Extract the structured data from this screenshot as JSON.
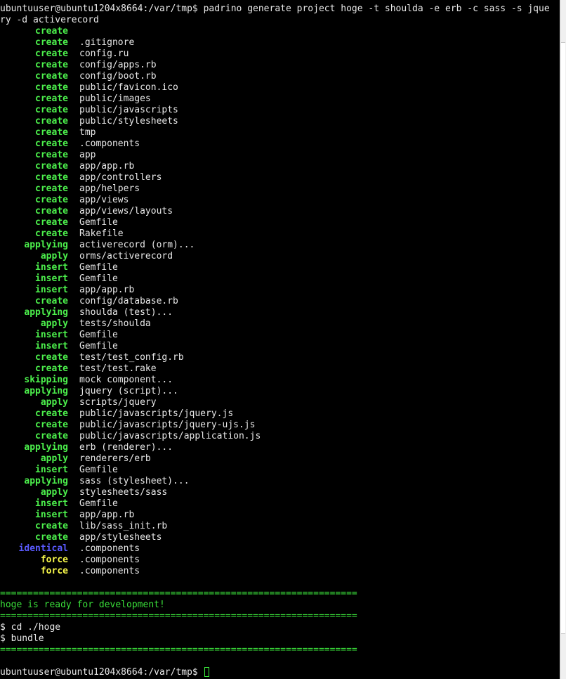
{
  "command": {
    "line1": "ubuntuuser@ubuntu1204x8664:/var/tmp$ padrino generate project hoge -t shoulda -e erb -c sass -s jque",
    "line2": "ry -d activerecord"
  },
  "output_lines": [
    {
      "status": "create",
      "color": "green",
      "path": ""
    },
    {
      "status": "create",
      "color": "green",
      "path": ".gitignore"
    },
    {
      "status": "create",
      "color": "green",
      "path": "config.ru"
    },
    {
      "status": "create",
      "color": "green",
      "path": "config/apps.rb"
    },
    {
      "status": "create",
      "color": "green",
      "path": "config/boot.rb"
    },
    {
      "status": "create",
      "color": "green",
      "path": "public/favicon.ico"
    },
    {
      "status": "create",
      "color": "green",
      "path": "public/images"
    },
    {
      "status": "create",
      "color": "green",
      "path": "public/javascripts"
    },
    {
      "status": "create",
      "color": "green",
      "path": "public/stylesheets"
    },
    {
      "status": "create",
      "color": "green",
      "path": "tmp"
    },
    {
      "status": "create",
      "color": "green",
      "path": ".components"
    },
    {
      "status": "create",
      "color": "green",
      "path": "app"
    },
    {
      "status": "create",
      "color": "green",
      "path": "app/app.rb"
    },
    {
      "status": "create",
      "color": "green",
      "path": "app/controllers"
    },
    {
      "status": "create",
      "color": "green",
      "path": "app/helpers"
    },
    {
      "status": "create",
      "color": "green",
      "path": "app/views"
    },
    {
      "status": "create",
      "color": "green",
      "path": "app/views/layouts"
    },
    {
      "status": "create",
      "color": "green",
      "path": "Gemfile"
    },
    {
      "status": "create",
      "color": "green",
      "path": "Rakefile"
    },
    {
      "status": "applying",
      "color": "green",
      "path": "activerecord (orm)..."
    },
    {
      "status": "apply",
      "color": "green",
      "path": "orms/activerecord"
    },
    {
      "status": "insert",
      "color": "green",
      "path": "Gemfile"
    },
    {
      "status": "insert",
      "color": "green",
      "path": "Gemfile"
    },
    {
      "status": "insert",
      "color": "green",
      "path": "app/app.rb"
    },
    {
      "status": "create",
      "color": "green",
      "path": "config/database.rb"
    },
    {
      "status": "applying",
      "color": "green",
      "path": "shoulda (test)..."
    },
    {
      "status": "apply",
      "color": "green",
      "path": "tests/shoulda"
    },
    {
      "status": "insert",
      "color": "green",
      "path": "Gemfile"
    },
    {
      "status": "insert",
      "color": "green",
      "path": "Gemfile"
    },
    {
      "status": "create",
      "color": "green",
      "path": "test/test_config.rb"
    },
    {
      "status": "create",
      "color": "green",
      "path": "test/test.rake"
    },
    {
      "status": "skipping",
      "color": "green",
      "path": "mock component..."
    },
    {
      "status": "applying",
      "color": "green",
      "path": "jquery (script)..."
    },
    {
      "status": "apply",
      "color": "green",
      "path": "scripts/jquery"
    },
    {
      "status": "create",
      "color": "green",
      "path": "public/javascripts/jquery.js"
    },
    {
      "status": "create",
      "color": "green",
      "path": "public/javascripts/jquery-ujs.js"
    },
    {
      "status": "create",
      "color": "green",
      "path": "public/javascripts/application.js"
    },
    {
      "status": "applying",
      "color": "green",
      "path": "erb (renderer)..."
    },
    {
      "status": "apply",
      "color": "green",
      "path": "renderers/erb"
    },
    {
      "status": "insert",
      "color": "green",
      "path": "Gemfile"
    },
    {
      "status": "applying",
      "color": "green",
      "path": "sass (stylesheet)..."
    },
    {
      "status": "apply",
      "color": "green",
      "path": "stylesheets/sass"
    },
    {
      "status": "insert",
      "color": "green",
      "path": "Gemfile"
    },
    {
      "status": "insert",
      "color": "green",
      "path": "app/app.rb"
    },
    {
      "status": "create",
      "color": "green",
      "path": "lib/sass_init.rb"
    },
    {
      "status": "create",
      "color": "green",
      "path": "app/stylesheets"
    },
    {
      "status": "identical",
      "color": "blue",
      "path": ".components"
    },
    {
      "status": "force",
      "color": "yellow",
      "path": ".components"
    },
    {
      "status": "force",
      "color": "yellow",
      "path": ".components"
    }
  ],
  "footer": {
    "rule": "=================================================================",
    "ready_message": "hoge is ready for development!",
    "next_steps": [
      "$ cd ./hoge",
      "$ bundle"
    ]
  },
  "final_prompt": "ubuntuuser@ubuntu1204x8664:/var/tmp$ ",
  "colors": {
    "green": "#4cf04c",
    "blue": "#5a5aff",
    "yellow": "#f8f84a",
    "background": "#000000",
    "foreground": "#e8e8e8"
  }
}
